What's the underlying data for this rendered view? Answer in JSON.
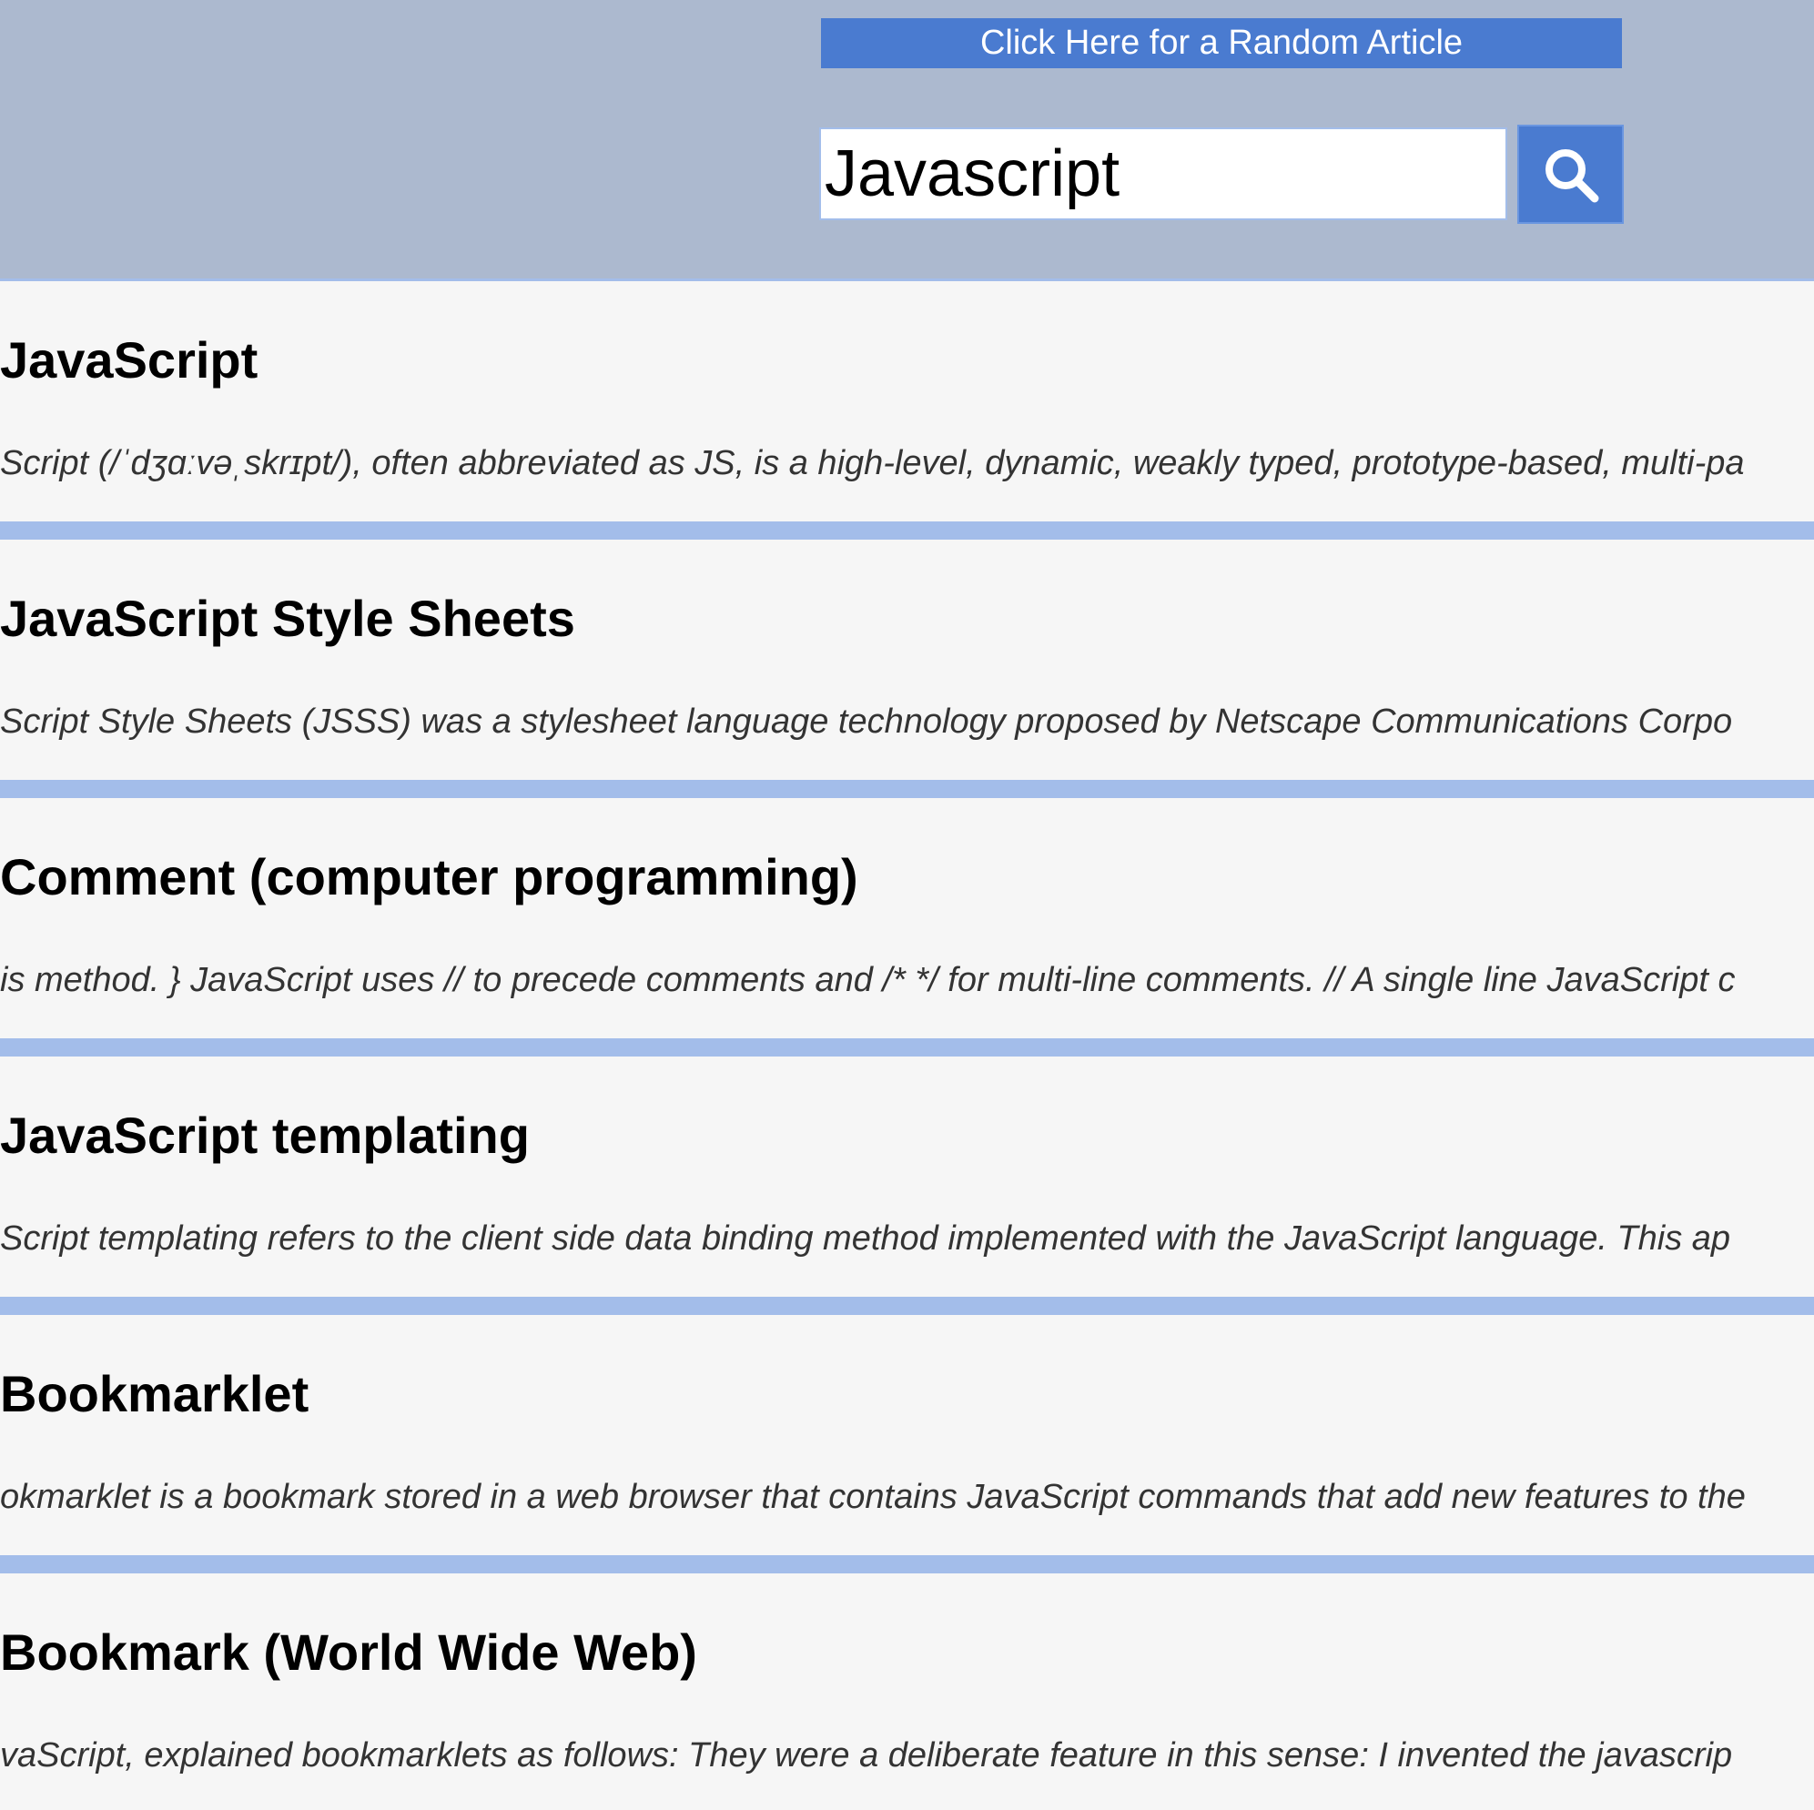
{
  "header": {
    "random_button_label": "Click Here for a Random Article",
    "search": {
      "value": "Javascript"
    },
    "search_button_icon": "search-icon"
  },
  "results": [
    {
      "title": "JavaScript",
      "snippet": "Script (/ˈdʒɑːvəˌskrɪpt/), often abbreviated as JS, is a high-level, dynamic, weakly typed, prototype-based, multi-pa"
    },
    {
      "title": "JavaScript Style Sheets",
      "snippet": "Script Style Sheets (JSSS) was a stylesheet language technology proposed by Netscape Communications Corpo"
    },
    {
      "title": "Comment (computer programming)",
      "snippet": "is method. } JavaScript uses // to precede comments and /* */ for multi-line comments. // A single line JavaScript c"
    },
    {
      "title": "JavaScript templating",
      "snippet": "Script templating refers to the client side data binding method implemented with the JavaScript language. This ap"
    },
    {
      "title": "Bookmarklet",
      "snippet": "okmarklet is a bookmark stored in a web browser that contains JavaScript commands that add new features to the"
    },
    {
      "title": "Bookmark (World Wide Web)",
      "snippet": "vaScript, explained bookmarklets as follows: They were a deliberate feature in this sense: I invented the javascrip"
    }
  ],
  "colors": {
    "header_bg": "#acb9cf",
    "accent": "#4a7bd0",
    "divider": "#a3bdea",
    "page_bg": "#f6f6f6"
  }
}
